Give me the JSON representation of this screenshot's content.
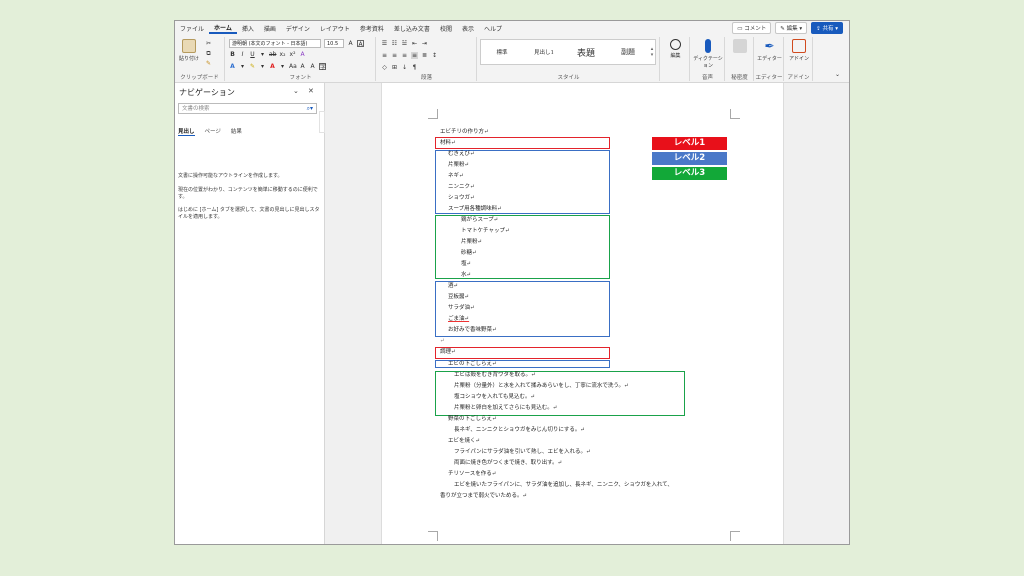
{
  "menu": {
    "tabs": [
      "ファイル",
      "ホーム",
      "挿入",
      "描画",
      "デザイン",
      "レイアウト",
      "参考資料",
      "差し込み文書",
      "校閲",
      "表示",
      "ヘルプ"
    ],
    "active": "ホーム",
    "comment": "コメント",
    "edit": "編集",
    "share": "共有"
  },
  "ribbon": {
    "paste": "貼り付け",
    "clipboard": "クリップボード",
    "font_name": "游明朝 (本文のフォント - 日本語)",
    "font_size": "10.5",
    "font": "フォント",
    "paragraph": "段落",
    "styles": [
      "標準",
      "見出し1",
      "表題",
      "副題"
    ],
    "style": "スタイル",
    "editing": "編集",
    "dictate": "ディクテーション",
    "voice": "音声",
    "sensitivity": "秘密度",
    "editor": "エディター",
    "addins": "アドイン",
    "editor_btn": "エディター",
    "addins_btn": "アドイン"
  },
  "nav": {
    "title": "ナビゲーション",
    "search_placeholder": "文書の検索",
    "tabs": [
      "見出し",
      "ページ",
      "結果"
    ],
    "text1": "文書に操作可能なアウトラインを作成します。",
    "text2": "現在の位置がわかり、コンテンツを簡単に移動するのに便利です。",
    "text3": "はじめに [ホーム] タブを選択して、文書の見出しに見出しスタイルを適用します。"
  },
  "doc": {
    "lines": [
      "エビチリの作り方↵",
      "材料↵",
      "むきえび↵",
      "片栗粉↵",
      "ネギ↵",
      "ニンニク↵",
      "ショウガ↵",
      "スープ用各種調味料↵",
      "鶏がらスープ↵",
      "トマトケチャップ↵",
      "片栗粉↵",
      "砂糖↵",
      "塩↵",
      "水↵",
      "酒↵",
      "豆板醤↵",
      "サラダ油↵",
      "ごま油↵",
      "お好みで香味野菜↵",
      "↵",
      "調理↵",
      "エビの下ごしらえ↵",
      "エビは殻をむき背ワタを取る。↵",
      "片栗粉（分量外）と水を入れて揉みあらいをし、丁寧に流水で洗う。↵",
      "塩コショウを入れても見込む。↵",
      "片栗粉と卵白を加えてさらにも見込む。↵",
      "野菜の下ごしらえ↵",
      "長ネギ、ニンニクとショウガをみじん切りにする。↵",
      "エビを焼く↵",
      "フライパンにサラダ油を引いて熱し、エビを入れる。↵",
      "両面に焼き色がつくまで焼き、取り出す。↵",
      "チリソースを作る↵",
      "エビを焼いたフライパンに、サラダ油を追加し、長ネギ、ニンニク、ショウガを入れて、",
      "香りが立つまで弱火でいためる。↵"
    ]
  },
  "legend": {
    "level1": "レベル1",
    "level2": "レベル2",
    "level3": "レベル3",
    "colors": {
      "level1": "#e8101a",
      "level2": "#4a78c8",
      "level3": "#12a838"
    }
  }
}
